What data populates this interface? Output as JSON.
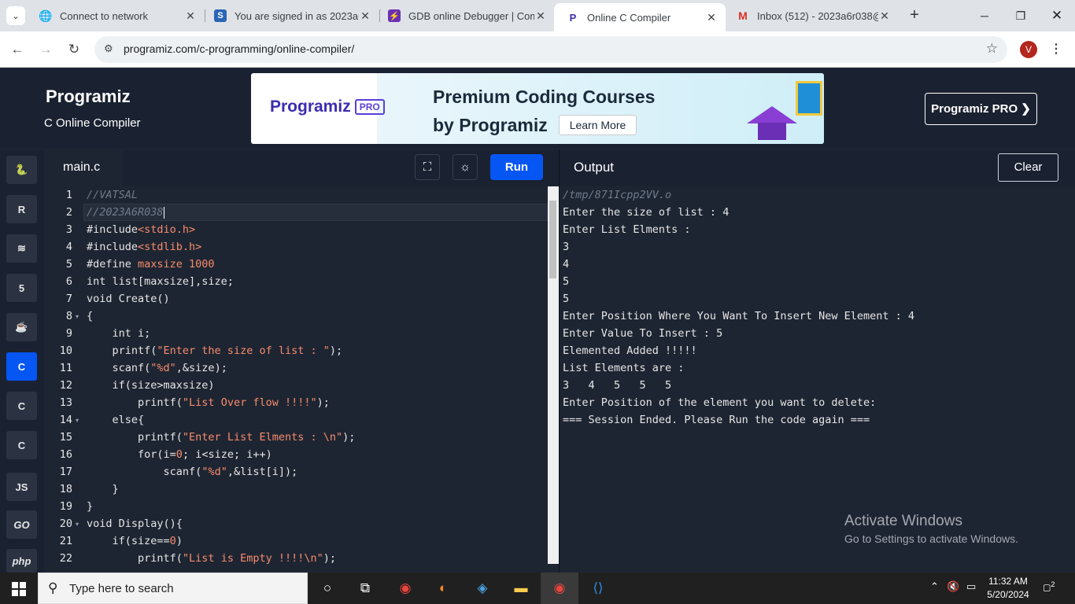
{
  "browser": {
    "tabs": [
      {
        "title": "Connect to network",
        "icon": "globe-icon"
      },
      {
        "title": "You are signed in as 2023a6r",
        "icon": "s-logo-icon"
      },
      {
        "title": "GDB online Debugger | Com",
        "icon": "gdb-logo-icon"
      },
      {
        "title": "Online C Compiler",
        "icon": "programiz-logo-icon"
      },
      {
        "title": "Inbox (512) - 2023a6r038@",
        "icon": "gmail-icon"
      }
    ],
    "active_tab_index": 3,
    "url": "programiz.com/c-programming/online-compiler/",
    "profile_initial": "V"
  },
  "header": {
    "logo": "Programiz",
    "subtitle": "C Online Compiler",
    "pro_button": "Programiz PRO ❯",
    "banner": {
      "logo": "Programiz",
      "logo_badge": "PRO",
      "headline1": "Premium Coding Courses",
      "headline2": "by Programiz",
      "cta": "Learn More"
    }
  },
  "languages": [
    {
      "name": "python",
      "glyph": "🐍"
    },
    {
      "name": "r",
      "glyph": "R"
    },
    {
      "name": "sql",
      "glyph": "≋"
    },
    {
      "name": "html",
      "glyph": "5"
    },
    {
      "name": "java",
      "glyph": "☕"
    },
    {
      "name": "c",
      "glyph": "C",
      "active": true
    },
    {
      "name": "cpp",
      "glyph": "C"
    },
    {
      "name": "csharp",
      "glyph": "C"
    },
    {
      "name": "js",
      "glyph": "JS"
    },
    {
      "name": "go",
      "glyph": "GO"
    },
    {
      "name": "php",
      "glyph": "php"
    }
  ],
  "editor": {
    "filename": "main.c",
    "run_label": "Run",
    "lines": [
      {
        "n": "1",
        "html": "<span class=\"c-cm\">//VATSAL</span>"
      },
      {
        "n": "2",
        "html": "<span class=\"c-cm\">//2023A6R038</span><span class=\"cursor\"></span>"
      },
      {
        "n": "3",
        "html": "#include<span class=\"c-str\">&lt;stdio.h&gt;</span>"
      },
      {
        "n": "4",
        "html": "#include<span class=\"c-str\">&lt;stdlib.h&gt;</span>"
      },
      {
        "n": "5",
        "html": "#define <span class=\"c-str\">maxsize 1000</span>"
      },
      {
        "n": "6",
        "html": "int list[maxsize],size;"
      },
      {
        "n": "7",
        "html": "void Create()"
      },
      {
        "n": "8",
        "html": "{",
        "fold": true
      },
      {
        "n": "9",
        "html": "    int i;"
      },
      {
        "n": "10",
        "html": "    printf(<span class=\"c-str\">\"Enter the size of list : \"</span>);"
      },
      {
        "n": "11",
        "html": "    scanf(<span class=\"c-str\">\"%d\"</span>,&amp;size);"
      },
      {
        "n": "12",
        "html": "    if(size&gt;maxsize)"
      },
      {
        "n": "13",
        "html": "        printf(<span class=\"c-str\">\"List Over flow !!!!\"</span>);"
      },
      {
        "n": "14",
        "html": "    else{",
        "fold": true
      },
      {
        "n": "15",
        "html": "        printf(<span class=\"c-str\">\"Enter List Elments : \\n\"</span>);"
      },
      {
        "n": "16",
        "html": "        for(i=<span class=\"c-num\">0</span>; i&lt;size; i++)"
      },
      {
        "n": "17",
        "html": "            scanf(<span class=\"c-str\">\"%d\"</span>,&amp;list[i]);"
      },
      {
        "n": "18",
        "html": "    }"
      },
      {
        "n": "19",
        "html": "}"
      },
      {
        "n": "20",
        "html": "void Display(){",
        "fold": true
      },
      {
        "n": "21",
        "html": "    if(size==<span class=\"c-num\">0</span>)"
      },
      {
        "n": "22",
        "html": "        printf(<span class=\"c-str\">\"List is Empty !!!!\\n\"</span>);"
      }
    ]
  },
  "output": {
    "title": "Output",
    "clear_label": "Clear",
    "lines": [
      {
        "text": "/tmp/871Icpp2VV.o",
        "dim": true
      },
      {
        "text": "Enter the size of list : 4"
      },
      {
        "text": "Enter List Elments :"
      },
      {
        "text": "3"
      },
      {
        "text": "4"
      },
      {
        "text": "5"
      },
      {
        "text": "5"
      },
      {
        "text": "Enter Position Where You Want To Insert New Element : 4"
      },
      {
        "text": "Enter Value To Insert : 5"
      },
      {
        "text": "Elemented Added !!!!!"
      },
      {
        "text": "List Elements are :"
      },
      {
        "text": "3   4   5   5   5"
      },
      {
        "text": "Enter Position of the element you want to delete:"
      },
      {
        "text": "=== Session Ended. Please Run the code again ==="
      }
    ]
  },
  "watermark": {
    "line1": "Activate Windows",
    "line2": "Go to Settings to activate Windows."
  },
  "taskbar": {
    "search_placeholder": "Type here to search",
    "time": "11:32 AM",
    "date": "5/20/2024",
    "notification_count": "2"
  }
}
